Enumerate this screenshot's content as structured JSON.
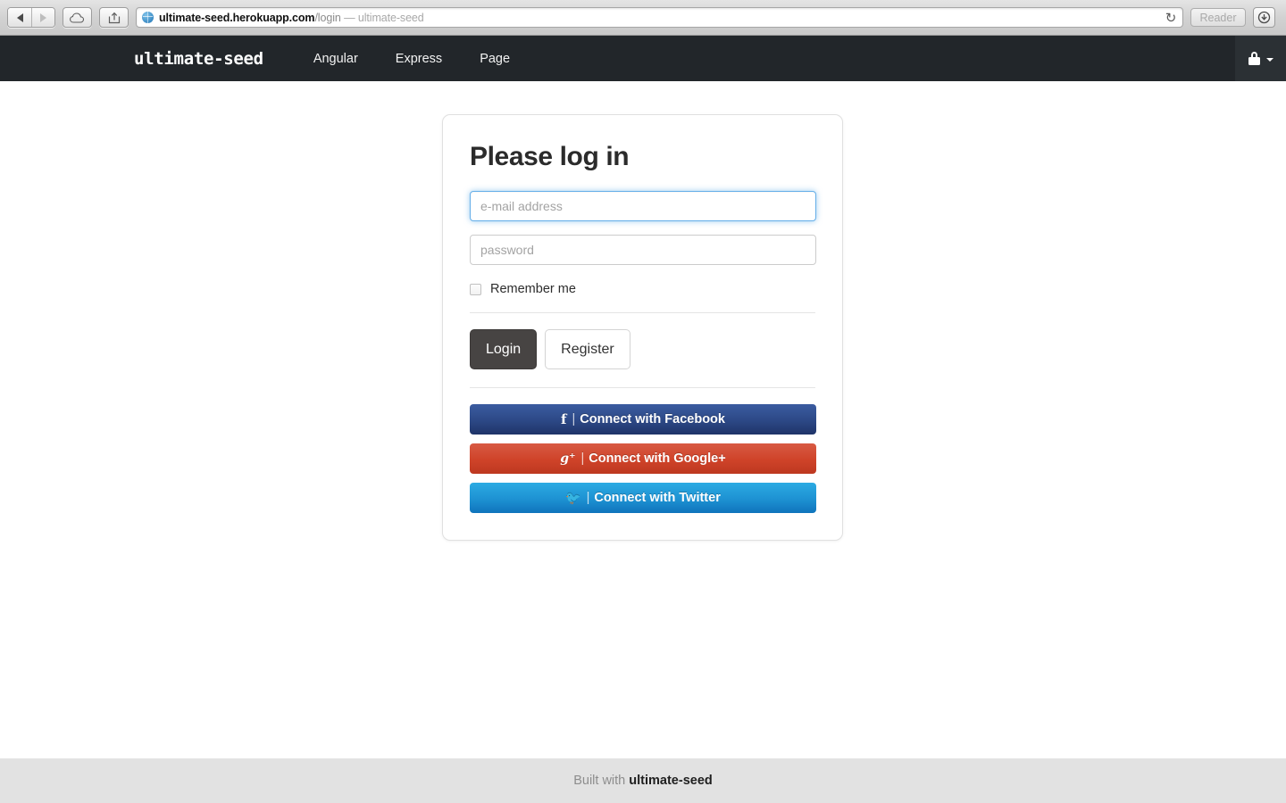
{
  "browser": {
    "back_icon": "triangle-left",
    "forward_icon": "triangle-right",
    "icloud_icon": "cloud-icon",
    "share_icon": "share-icon",
    "site_icon": "globe-icon",
    "url_domain": "ultimate-seed.herokuapp.com",
    "url_path": "/login",
    "url_title": "— ultimate-seed",
    "reload_glyph": "↻",
    "reader_label": "Reader",
    "download_glyph": "▼"
  },
  "navbar": {
    "brand": "ultimate-seed",
    "links": [
      {
        "label": "Angular"
      },
      {
        "label": "Express"
      },
      {
        "label": "Page"
      }
    ],
    "account_icon": "lock-icon",
    "account_caret": "chevron-down-icon",
    "background": "#22262a"
  },
  "login_card": {
    "title": "Please log in",
    "email": {
      "placeholder": "e-mail address",
      "value": "",
      "focused": true
    },
    "password": {
      "placeholder": "password",
      "value": ""
    },
    "remember_me": {
      "label": "Remember me",
      "checked": false
    },
    "primary_buttons": [
      {
        "label": "Login",
        "style": "dark"
      },
      {
        "label": "Register",
        "style": "light"
      }
    ],
    "social_buttons": [
      {
        "glyph": "f",
        "separator": "|",
        "label": "Connect with Facebook",
        "color": "#2c4886"
      },
      {
        "glyph": "g⁺",
        "separator": "|",
        "label": "Connect with Google+",
        "color": "#cf4329"
      },
      {
        "glyph": "🐦",
        "separator": "|",
        "label": "Connect with Twitter",
        "color": "#1d91d2"
      }
    ]
  },
  "footer": {
    "prefix": "Built with ",
    "brand": "ultimate-seed"
  }
}
